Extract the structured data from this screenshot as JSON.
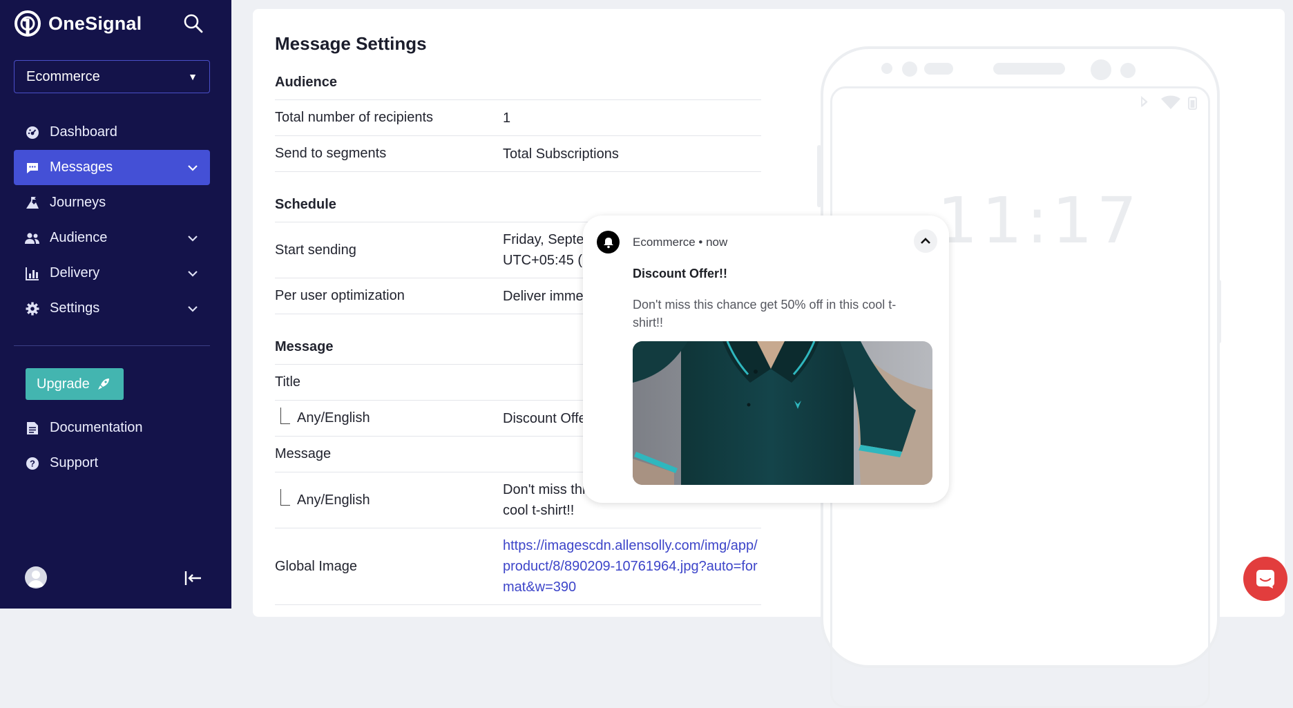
{
  "app": {
    "brand": "OneSignal"
  },
  "sidebar": {
    "app_selector": {
      "value": "Ecommerce"
    },
    "nav": [
      {
        "label": "Dashboard",
        "icon": "dashboard-icon",
        "active": false,
        "expandable": false
      },
      {
        "label": "Messages",
        "icon": "message-icon",
        "active": true,
        "expandable": true
      },
      {
        "label": "Journeys",
        "icon": "journeys-icon",
        "active": false,
        "expandable": false
      },
      {
        "label": "Audience",
        "icon": "users-icon",
        "active": false,
        "expandable": true
      },
      {
        "label": "Delivery",
        "icon": "bar-chart-icon",
        "active": false,
        "expandable": true
      },
      {
        "label": "Settings",
        "icon": "gear-icon",
        "active": false,
        "expandable": true
      }
    ],
    "upgrade_label": "Upgrade",
    "bottom_links": [
      {
        "label": "Documentation",
        "icon": "document-icon"
      },
      {
        "label": "Support",
        "icon": "help-icon"
      }
    ]
  },
  "main": {
    "title": "Message Settings",
    "audience": {
      "heading": "Audience",
      "recipients_label": "Total number of recipients",
      "recipients_value": "1",
      "segments_label": "Send to segments",
      "segments_value": "Total Subscriptions"
    },
    "schedule": {
      "heading": "Schedule",
      "start_label": "Start sending",
      "start_value": "Friday, September 13, 2024 11:19 AM UTC+05:45 (23 minutes ago)",
      "optimization_label": "Per user optimization",
      "optimization_value": "Deliver immediately"
    },
    "message": {
      "heading": "Message",
      "title_label": "Title",
      "title_lang": "Any/English",
      "title_value": "Discount Offer!!",
      "message_label": "Message",
      "message_lang": "Any/English",
      "message_value": "Don't miss this chance get 50% off in this cool t-shirt!!",
      "image_label": "Global Image",
      "image_value": "https://imagescdn.allensolly.com/img/app/product/8/890209-10761964.jpg?auto=format&w=390"
    }
  },
  "preview": {
    "clock": "11:17",
    "notification": {
      "source": "Ecommerce • now",
      "title": "Discount Offer!!",
      "body": "Don't miss this chance get 50% off in this cool t-shirt!!"
    }
  },
  "colors": {
    "sidebar_bg": "#14134a",
    "active_nav": "#4450d6",
    "upgrade": "#43b5b0",
    "link": "#3d45c9",
    "chat": "#e23d3d"
  }
}
